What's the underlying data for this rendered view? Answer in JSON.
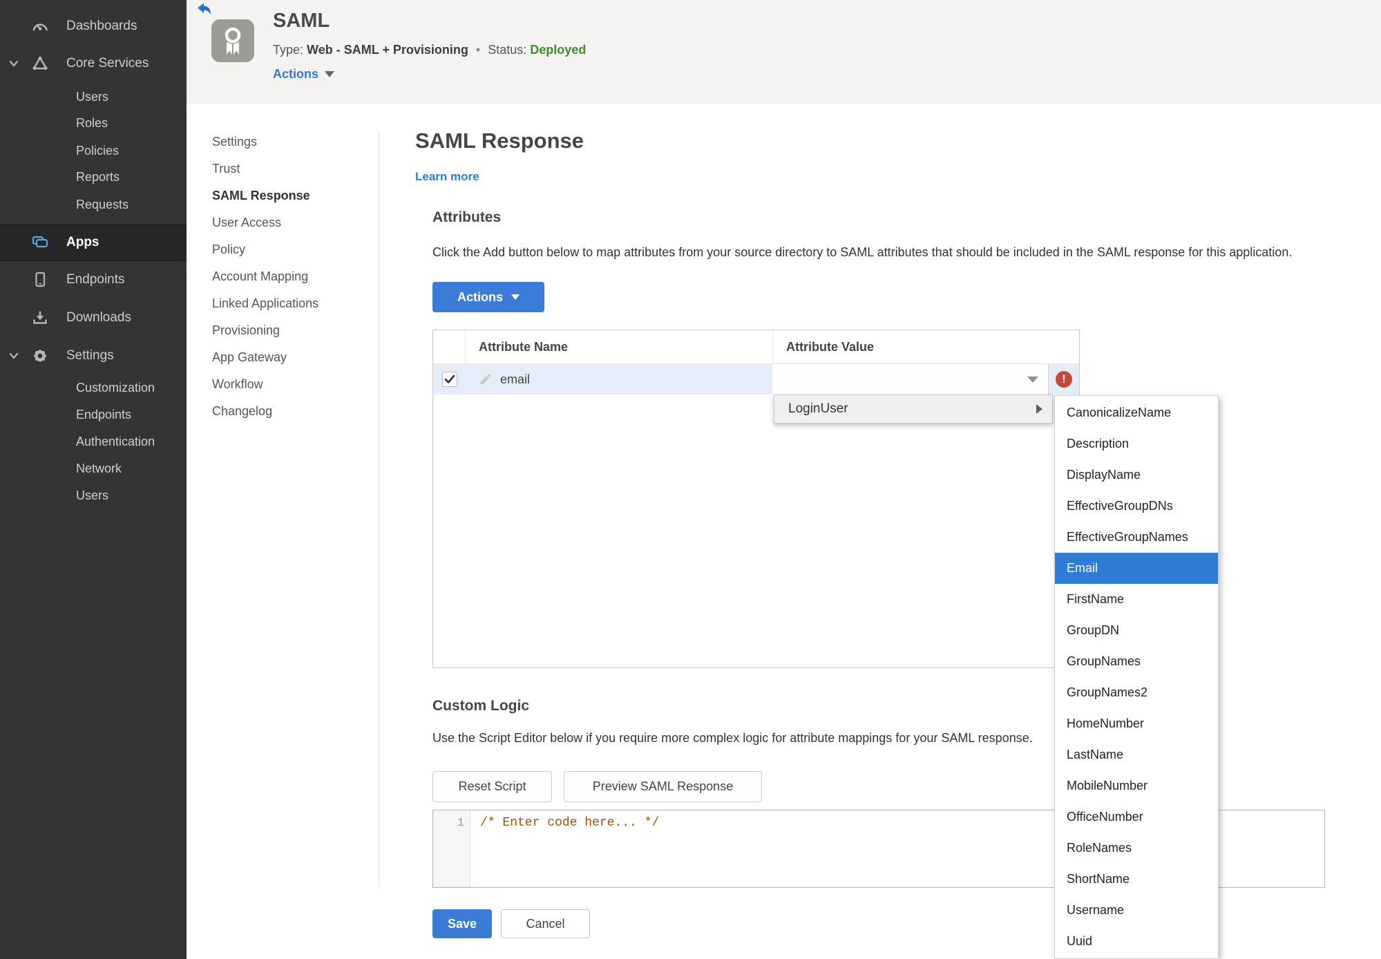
{
  "colors": {
    "accent_blue": "#3b7cd9",
    "selection_blue": "#2e7cd6",
    "status_green": "#3e8e2e",
    "error_red": "#c74634",
    "row_highlight": "#e4edf8",
    "sidebar_bg": "#343434"
  },
  "sidebar": {
    "items": [
      {
        "label": "Dashboards",
        "icon": "gauge-icon"
      },
      {
        "label": "Core Services",
        "icon": "core-services-icon",
        "expanded": true,
        "children": [
          "Users",
          "Roles",
          "Policies",
          "Reports",
          "Requests"
        ]
      },
      {
        "label": "Apps",
        "icon": "apps-icon",
        "selected": true
      },
      {
        "label": "Endpoints",
        "icon": "endpoint-device-icon"
      },
      {
        "label": "Downloads",
        "icon": "download-icon"
      },
      {
        "label": "Settings",
        "icon": "gear-icon",
        "expanded": true,
        "children": [
          "Customization",
          "Endpoints",
          "Authentication",
          "Network",
          "Users"
        ]
      }
    ]
  },
  "header": {
    "title": "SAML",
    "type_label": "Type:",
    "type_value": "Web - SAML + Provisioning",
    "separator": "•",
    "status_label": "Status:",
    "status_value": "Deployed",
    "actions_label": "Actions"
  },
  "subnav": {
    "active": "SAML Response",
    "items": [
      "Settings",
      "Trust",
      "SAML Response",
      "User Access",
      "Policy",
      "Account Mapping",
      "Linked Applications",
      "Provisioning",
      "App Gateway",
      "Workflow",
      "Changelog"
    ]
  },
  "main": {
    "page_title": "SAML Response",
    "learn_more": "Learn more",
    "attributes": {
      "heading": "Attributes",
      "description": "Click the Add button below to map attributes from your source directory to SAML attributes that should be included in the SAML response for this application.",
      "actions_button": "Actions",
      "table": {
        "header_name": "Attribute Name",
        "header_value": "Attribute Value",
        "rows": [
          {
            "name": "email",
            "value": "",
            "checked": true,
            "error": "!"
          }
        ]
      }
    },
    "custom_logic": {
      "heading": "Custom Logic",
      "description": "Use the Script Editor below if you require more complex logic for attribute mappings for your SAML response.",
      "reset_button": "Reset Script",
      "preview_button": "Preview SAML Response",
      "editor": {
        "line_number": "1",
        "code": "/* Enter code here... */"
      }
    },
    "save_button": "Save",
    "cancel_button": "Cancel"
  },
  "menus": {
    "attribute_value_menu": {
      "label": "LoginUser"
    },
    "login_user_submenu": {
      "selected": "Email",
      "items": [
        "CanonicalizeName",
        "Description",
        "DisplayName",
        "EffectiveGroupDNs",
        "EffectiveGroupNames",
        "Email",
        "FirstName",
        "GroupDN",
        "GroupNames",
        "GroupNames2",
        "HomeNumber",
        "LastName",
        "MobileNumber",
        "OfficeNumber",
        "RoleNames",
        "ShortName",
        "Username",
        "Uuid"
      ]
    }
  }
}
